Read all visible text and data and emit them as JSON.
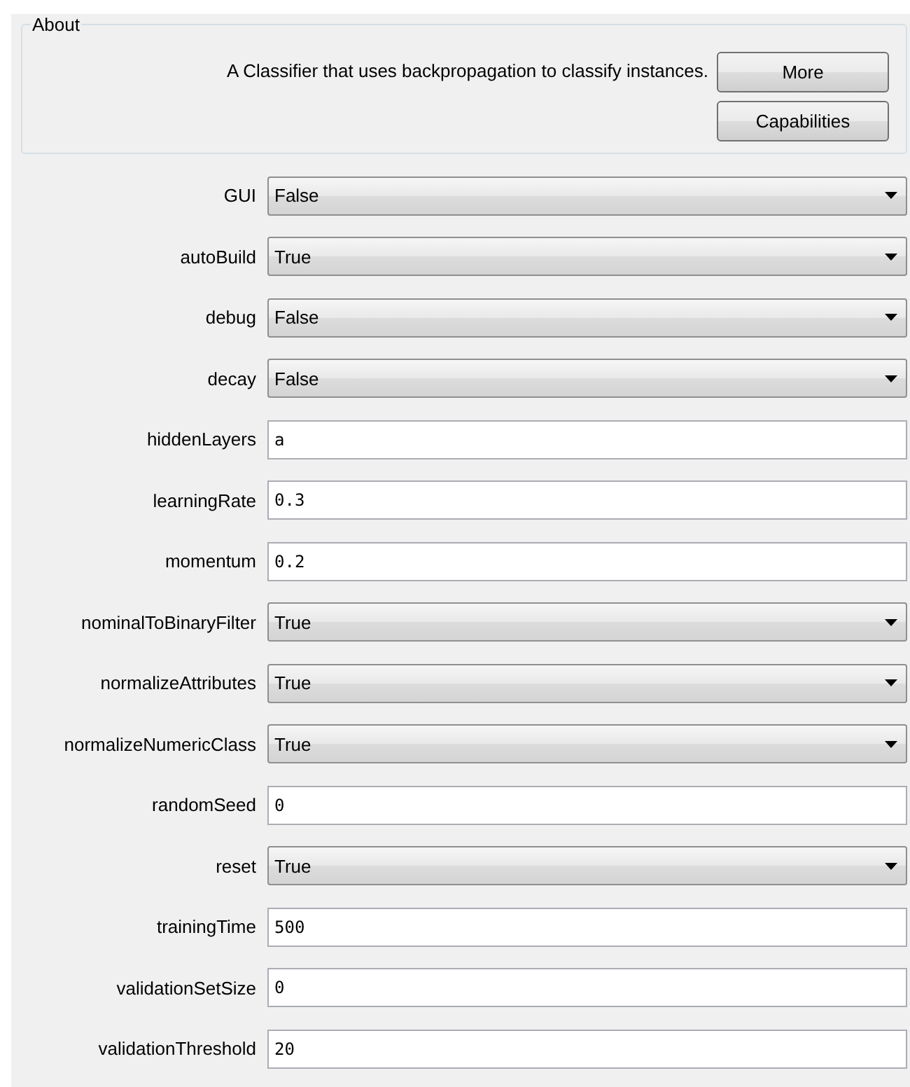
{
  "about": {
    "title": "About",
    "description": "A Classifier that uses backpropagation to classify instances.",
    "buttons": [
      "More",
      "Capabilities"
    ]
  },
  "properties": [
    {
      "label": "GUI",
      "kind": "choice",
      "value": "False"
    },
    {
      "label": "autoBuild",
      "kind": "choice",
      "value": "True"
    },
    {
      "label": "debug",
      "kind": "choice",
      "value": "False"
    },
    {
      "label": "decay",
      "kind": "choice",
      "value": "False"
    },
    {
      "label": "hiddenLayers",
      "kind": "text",
      "value": "a"
    },
    {
      "label": "learningRate",
      "kind": "text",
      "value": "0.3"
    },
    {
      "label": "momentum",
      "kind": "text",
      "value": "0.2"
    },
    {
      "label": "nominalToBinaryFilter",
      "kind": "choice",
      "value": "True"
    },
    {
      "label": "normalizeAttributes",
      "kind": "choice",
      "value": "True"
    },
    {
      "label": "normalizeNumericClass",
      "kind": "choice",
      "value": "True"
    },
    {
      "label": "randomSeed",
      "kind": "text",
      "value": "0"
    },
    {
      "label": "reset",
      "kind": "choice",
      "value": "True"
    },
    {
      "label": "trainingTime",
      "kind": "text",
      "value": "500"
    },
    {
      "label": "validationSetSize",
      "kind": "text",
      "value": "0"
    },
    {
      "label": "validationThreshold",
      "kind": "text",
      "value": "20"
    }
  ]
}
